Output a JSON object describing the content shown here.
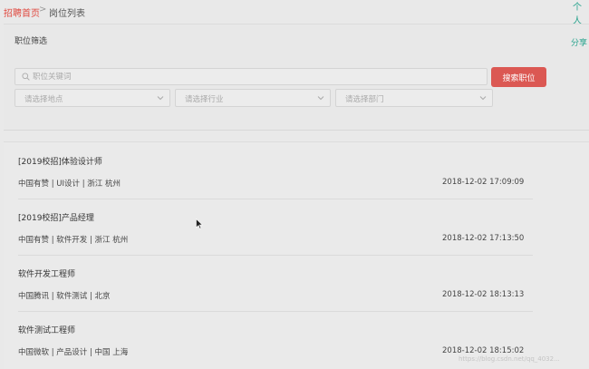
{
  "breadcrumb": {
    "home": "招聘首页",
    "separator": ">",
    "current": "岗位列表"
  },
  "header": {
    "top_right": "个人"
  },
  "filter": {
    "title": "职位筛选",
    "share": "分享",
    "search_placeholder": "职位关键词",
    "search_button": "搜索职位",
    "location_placeholder": "请选择地点",
    "industry_placeholder": "请选择行业",
    "department_placeholder": "请选择部门"
  },
  "jobs": [
    {
      "title": "[2019校招]体验设计师",
      "meta": "中国有赞 | UI设计 | 浙江 杭州",
      "time": "2018-12-02 17:09:09"
    },
    {
      "title": "[2019校招]产品经理",
      "meta": "中国有赞 | 软件开发 | 浙江 杭州",
      "time": "2018-12-02 17:13:50"
    },
    {
      "title": "软件开发工程师",
      "meta": "中国腾讯 | 软件测试 | 北京",
      "time": "2018-12-02 18:13:13"
    },
    {
      "title": "软件测试工程师",
      "meta": "中国微软 | 产品设计 | 中国 上海",
      "time": "2018-12-02 18:15:02"
    }
  ],
  "watermark": "https://blog.csdn.net/qq_4032...",
  "colors": {
    "accent_red": "#db5853",
    "accent_teal": "#27a38d",
    "breadcrumb_red": "#e0483e"
  }
}
